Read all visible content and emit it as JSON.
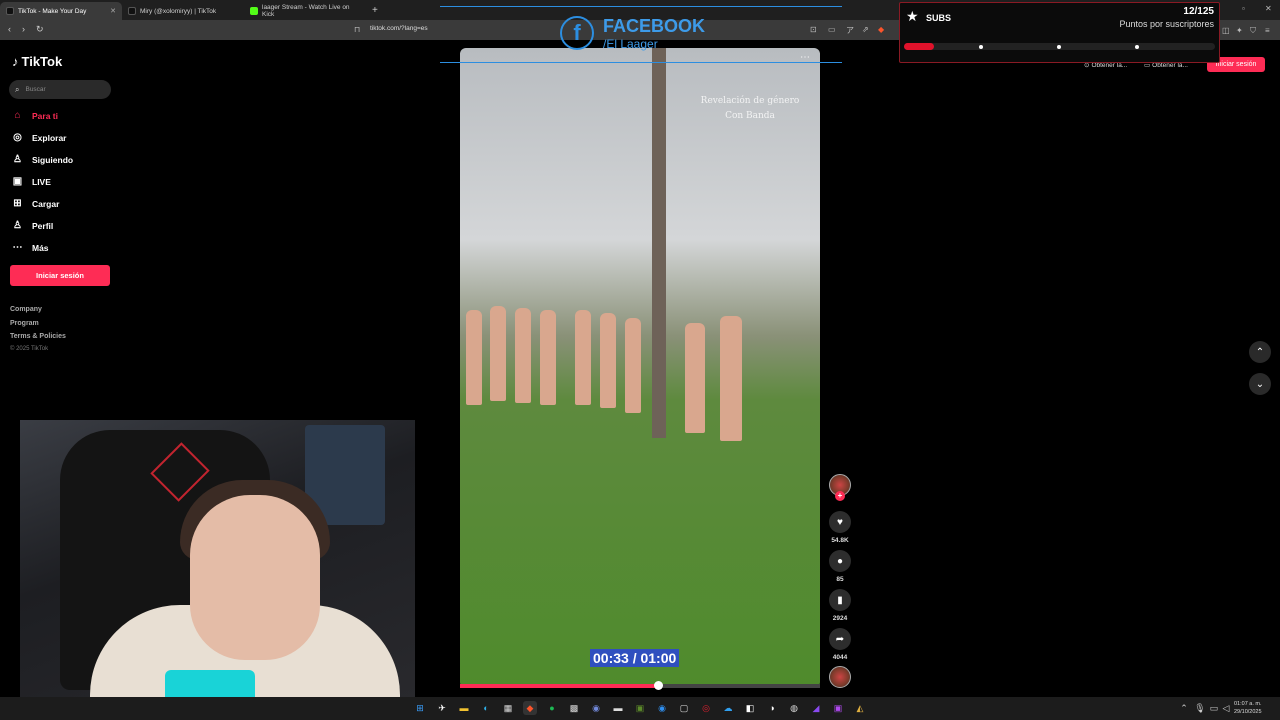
{
  "browser": {
    "tabs": [
      {
        "title": "TikTok - Make Your Day",
        "active": true
      },
      {
        "title": "Miry (@xolomiryy) | TikTok",
        "active": false
      },
      {
        "title": "laager Stream - Watch Live on Kick",
        "active": false
      }
    ],
    "url": "tiktok.com/?lang=es"
  },
  "sidebar": {
    "logo": "TikTok",
    "search_placeholder": "Buscar",
    "items": [
      {
        "label": "Para ti",
        "icon": "home-icon"
      },
      {
        "label": "Explorar",
        "icon": "compass-icon"
      },
      {
        "label": "Siguiendo",
        "icon": "following-icon"
      },
      {
        "label": "LIVE",
        "icon": "live-icon"
      },
      {
        "label": "Cargar",
        "icon": "upload-icon"
      },
      {
        "label": "Perfil",
        "icon": "profile-icon"
      },
      {
        "label": "Más",
        "icon": "more-icon"
      }
    ],
    "login_label": "Iniciar sesión",
    "footer_links": [
      "Company",
      "Program",
      "Terms & Policies"
    ],
    "copyright": "© 2025 TikTok"
  },
  "header": {
    "buttons": [
      "Obtener la...",
      "Obtener la..."
    ],
    "login_label": "Iniciar sesión"
  },
  "video": {
    "overlay_text_line1": "Revelación de género",
    "overlay_text_line2": "Con Banda",
    "timecode": "00:33 / 01:00",
    "progress": 0.55
  },
  "facebook_overlay": {
    "title": "FACEBOOK",
    "handle": "/El Laager"
  },
  "actions": {
    "likes": "54.8K",
    "comments": "85",
    "saves": "2924",
    "shares": "4044"
  },
  "subs_widget": {
    "title": "SUBS",
    "count": "12/125",
    "label": "Puntos por suscriptores",
    "progress": 0.096
  },
  "taskbar": {
    "time": "01:07 a. m.",
    "date": "29/10/2025"
  }
}
